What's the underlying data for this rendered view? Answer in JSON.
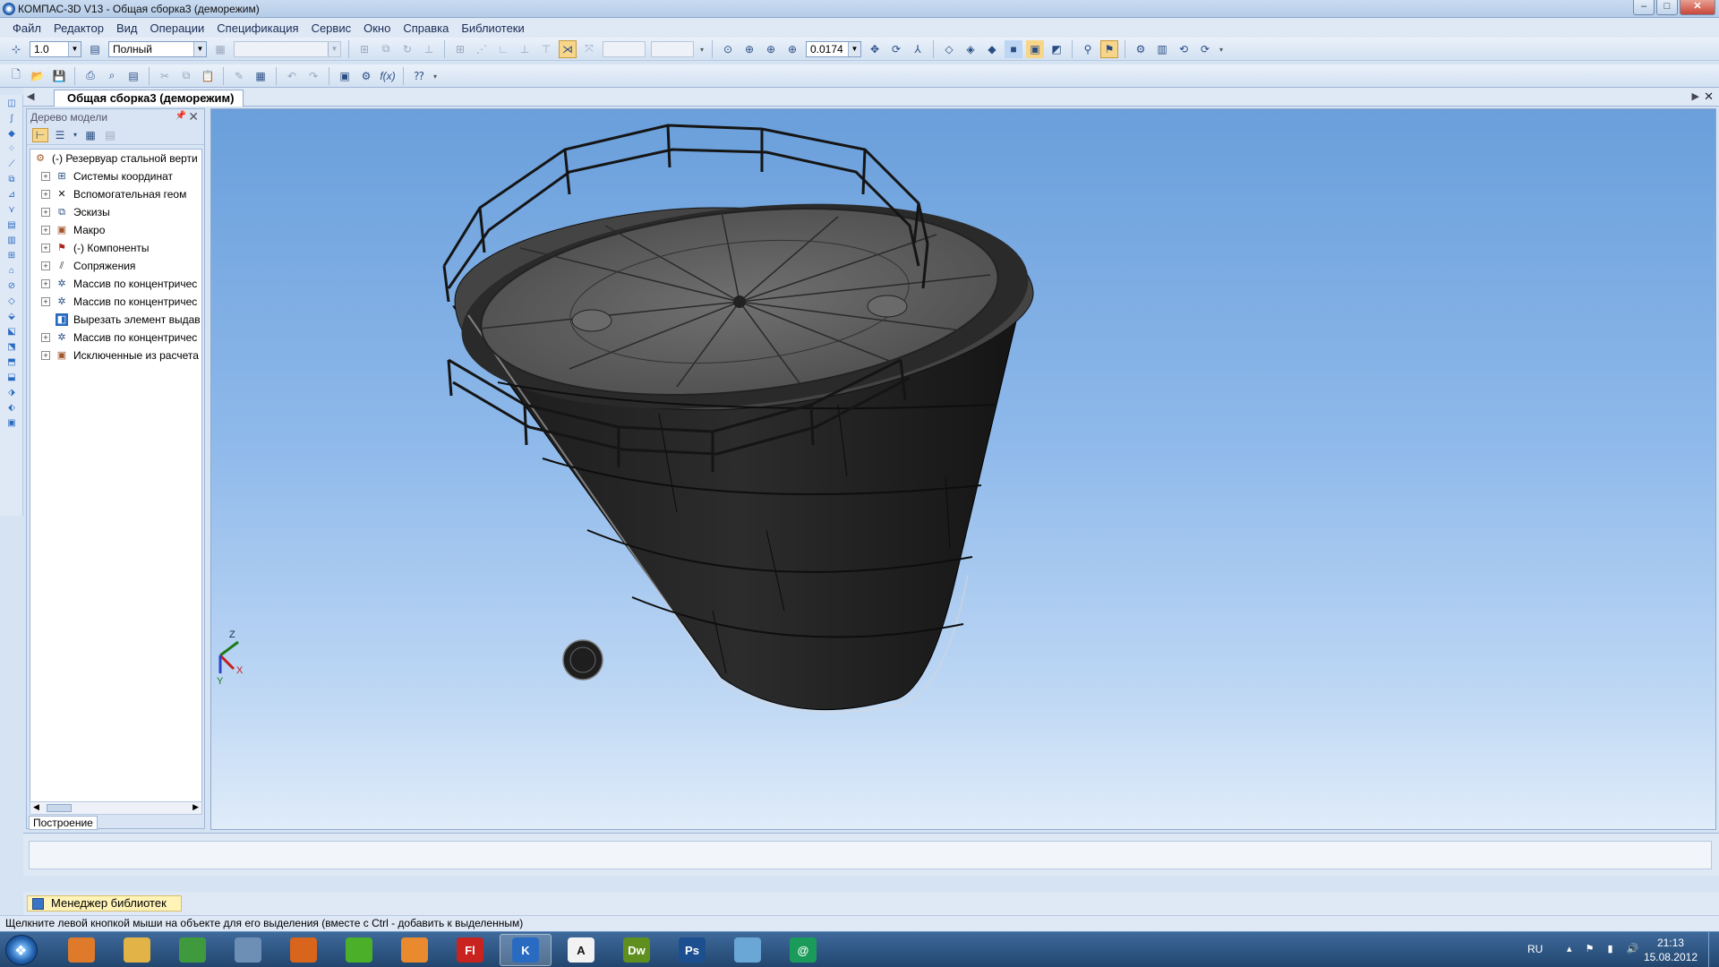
{
  "window": {
    "title": "КОМПАС-3D V13 - Общая сборка3 (деморежим)",
    "buttons": [
      "–",
      "□",
      "✕"
    ]
  },
  "menu": [
    "Файл",
    "Редактор",
    "Вид",
    "Операции",
    "Спецификация",
    "Сервис",
    "Окно",
    "Справка",
    "Библиотеки"
  ],
  "toolbar1": {
    "step_value": "1.0",
    "view_mode": "Полный",
    "zoom_value": "0.0174"
  },
  "document_tab": "Общая сборка3 (деморежим)",
  "model_tree": {
    "title": "Дерево модели",
    "root": "(-) Резервуар стальной верти",
    "items": [
      {
        "label": "Системы координат",
        "icon": "coord-system-icon"
      },
      {
        "label": "Вспомогательная геом",
        "icon": "aux-geometry-icon"
      },
      {
        "label": "Эскизы",
        "icon": "sketch-icon"
      },
      {
        "label": "Макро",
        "icon": "macro-icon"
      },
      {
        "label": "(-) Компоненты",
        "icon": "components-icon"
      },
      {
        "label": "Сопряжения",
        "icon": "mates-icon"
      },
      {
        "label": "Массив по концентричес",
        "icon": "circular-array-icon"
      },
      {
        "label": "Массив по концентричес",
        "icon": "circular-array-icon"
      },
      {
        "label": "Вырезать элемент выдав",
        "icon": "cut-extrude-icon"
      },
      {
        "label": "Массив по концентричес",
        "icon": "circular-array-icon"
      },
      {
        "label": "Исключенные из расчета",
        "icon": "excluded-icon"
      }
    ],
    "bottom_tab": "Построение"
  },
  "axis_labels": {
    "z": "Z",
    "x": "X",
    "y": "Y"
  },
  "library_manager": "Менеджер библиотек",
  "status_text": "Щелкните левой кнопкой мыши на объекте для его выделения (вместе с Ctrl - добавить к выделенным)",
  "taskbar": {
    "apps": [
      {
        "name": "media-player-icon",
        "label": "",
        "color": "#e07a2b"
      },
      {
        "name": "explorer-icon",
        "label": "",
        "color": "#e2b447"
      },
      {
        "name": "chrome-icon",
        "label": "",
        "color": "#3f9a3d"
      },
      {
        "name": "safari-icon",
        "label": "",
        "color": "#6e8fb5"
      },
      {
        "name": "firefox-icon",
        "label": "",
        "color": "#d9641c"
      },
      {
        "name": "icq-icon",
        "label": "",
        "color": "#4caf2a"
      },
      {
        "name": "chat-icon",
        "label": "",
        "color": "#e98a2e"
      },
      {
        "name": "flash-icon",
        "label": "Fl",
        "color": "#c8231e"
      },
      {
        "name": "kompas-icon",
        "label": "K",
        "color": "#2a6bc2"
      },
      {
        "name": "font-icon",
        "label": "A",
        "color": "#f2f2f2"
      },
      {
        "name": "dreamweaver-icon",
        "label": "Dw",
        "color": "#5f8f1f"
      },
      {
        "name": "photoshop-icon",
        "label": "Ps",
        "color": "#1c4f8f"
      },
      {
        "name": "qip-icon",
        "label": "",
        "color": "#6aa6d6"
      },
      {
        "name": "mail-agent-icon",
        "label": "@",
        "color": "#1b9b5a"
      }
    ],
    "lang": "RU",
    "time": "21:13",
    "date": "15.08.2012"
  }
}
